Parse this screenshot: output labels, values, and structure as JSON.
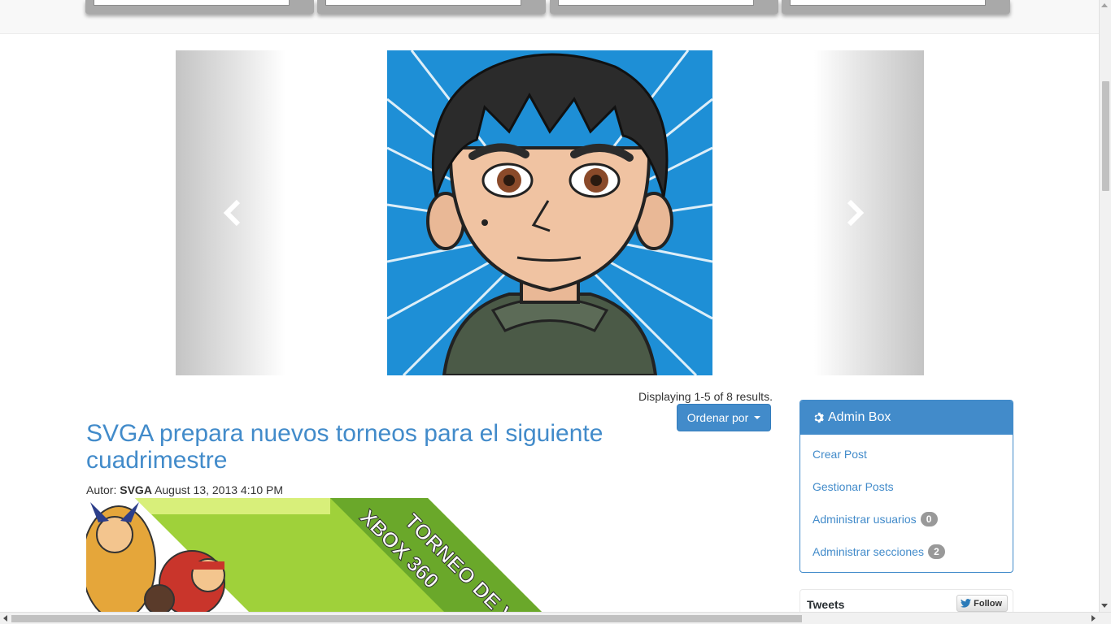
{
  "nav": {
    "tiles": [
      "",
      "",
      "",
      ""
    ]
  },
  "carousel": {
    "prev_label": "Previous",
    "next_label": "Next",
    "slide_count": 4,
    "active_index": 3
  },
  "listing": {
    "results_text": "Displaying 1-5 of 8 results.",
    "sort_label": "Ordenar por"
  },
  "post": {
    "title": "SVGA prepara nuevos torneos para el siguiente cuadrimestre",
    "author_prefix": "Autor:",
    "author": "SVGA",
    "date": "August 13, 2013 4:10 PM",
    "banner_text_1": "TORNEO DE VI",
    "banner_text_2": "XBOX 360"
  },
  "admin_box": {
    "title": "Admin Box",
    "icon": "gear-icon",
    "items": [
      {
        "label": "Crear Post"
      },
      {
        "label": "Gestionar Posts"
      },
      {
        "label": "Administrar usuarios",
        "badge": "0"
      },
      {
        "label": "Administrar secciones",
        "badge": "2"
      }
    ]
  },
  "tweets": {
    "title": "Tweets",
    "follow_label": "Follow"
  },
  "colors": {
    "primary": "#428bca",
    "badge": "#999999",
    "banner_green": "#8cc63f"
  }
}
